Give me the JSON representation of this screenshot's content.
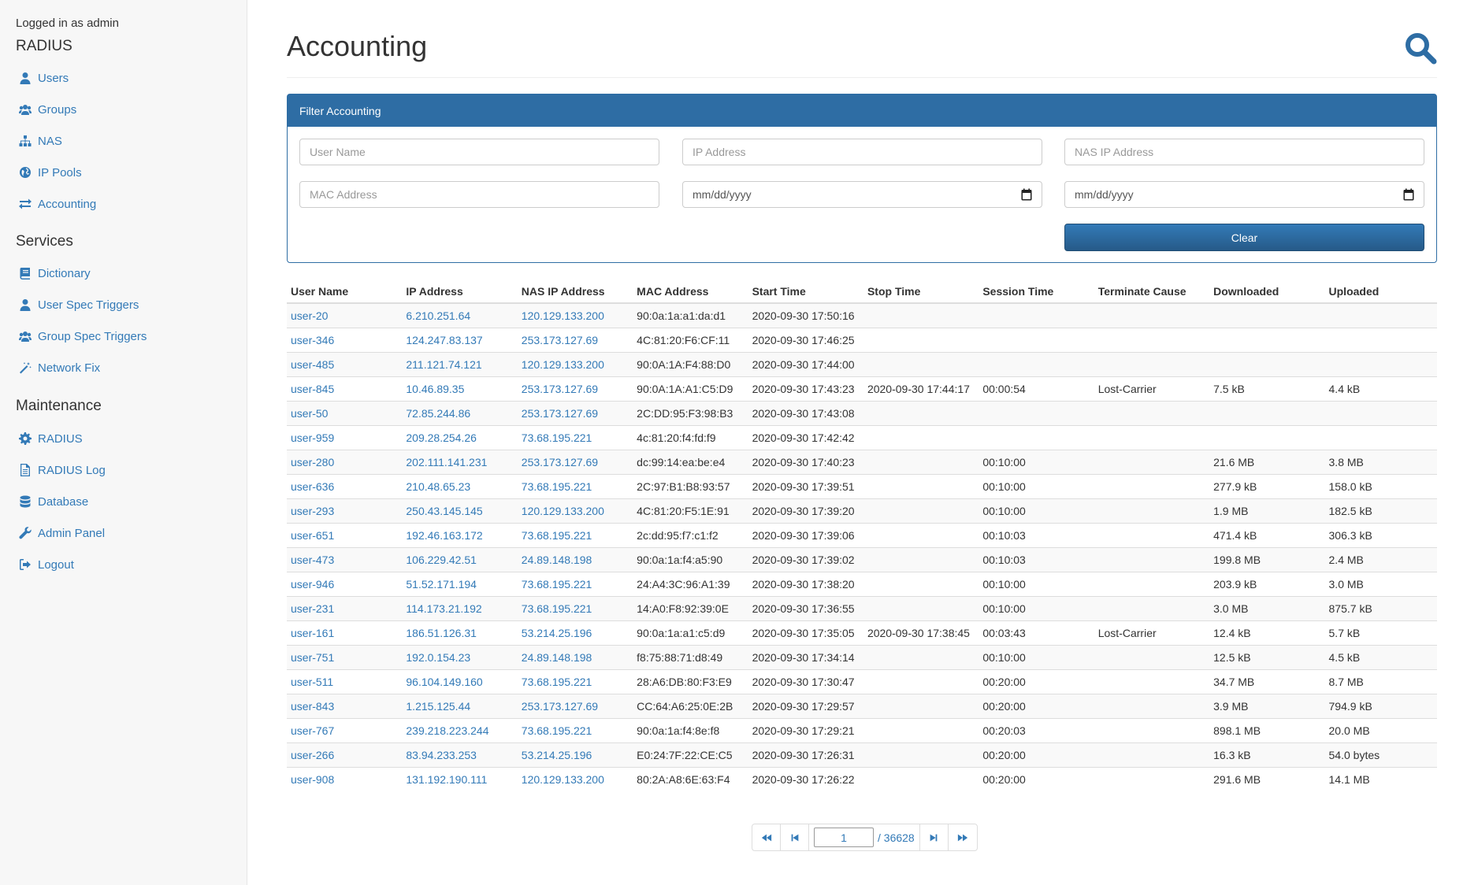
{
  "sidebar": {
    "logged_in": "Logged in as admin",
    "sections": [
      {
        "title": "RADIUS",
        "items": [
          {
            "label": "Users",
            "icon": "user-icon"
          },
          {
            "label": "Groups",
            "icon": "users-icon"
          },
          {
            "label": "NAS",
            "icon": "sitemap-icon"
          },
          {
            "label": "IP Pools",
            "icon": "globe-icon"
          },
          {
            "label": "Accounting",
            "icon": "exchange-icon"
          }
        ]
      },
      {
        "title": "Services",
        "items": [
          {
            "label": "Dictionary",
            "icon": "book-icon"
          },
          {
            "label": "User Spec Triggers",
            "icon": "user-icon"
          },
          {
            "label": "Group Spec Triggers",
            "icon": "users-icon"
          },
          {
            "label": "Network Fix",
            "icon": "magic-icon"
          }
        ]
      },
      {
        "title": "Maintenance",
        "items": [
          {
            "label": "RADIUS",
            "icon": "gear-icon"
          },
          {
            "label": "RADIUS Log",
            "icon": "file-text-icon"
          },
          {
            "label": "Database",
            "icon": "database-icon"
          },
          {
            "label": "Admin Panel",
            "icon": "wrench-icon"
          },
          {
            "label": "Logout",
            "icon": "sign-out-icon"
          }
        ]
      }
    ]
  },
  "main": {
    "title": "Accounting",
    "filter": {
      "title": "Filter Accounting",
      "user_name_placeholder": "User Name",
      "ip_placeholder": "IP Address",
      "nas_ip_placeholder": "NAS IP Address",
      "mac_placeholder": "MAC Address",
      "date_from": "mm/dd/yyyy",
      "date_to": "mm/dd/yyyy",
      "clear_label": "Clear"
    },
    "table": {
      "columns": [
        "User Name",
        "IP Address",
        "NAS IP Address",
        "MAC Address",
        "Start Time",
        "Stop Time",
        "Session Time",
        "Terminate Cause",
        "Downloaded",
        "Uploaded"
      ],
      "rows": [
        [
          "user-20",
          "6.210.251.64",
          "120.129.133.200",
          "90:0a:1a:a1:da:d1",
          "2020-09-30 17:50:16",
          "",
          "",
          "",
          "",
          ""
        ],
        [
          "user-346",
          "124.247.83.137",
          "253.173.127.69",
          "4C:81:20:F6:CF:11",
          "2020-09-30 17:46:25",
          "",
          "",
          "",
          "",
          ""
        ],
        [
          "user-485",
          "211.121.74.121",
          "120.129.133.200",
          "90:0A:1A:F4:88:D0",
          "2020-09-30 17:44:00",
          "",
          "",
          "",
          "",
          ""
        ],
        [
          "user-845",
          "10.46.89.35",
          "253.173.127.69",
          "90:0A:1A:A1:C5:D9",
          "2020-09-30 17:43:23",
          "2020-09-30 17:44:17",
          "00:00:54",
          "Lost-Carrier",
          "7.5 kB",
          "4.4 kB"
        ],
        [
          "user-50",
          "72.85.244.86",
          "253.173.127.69",
          "2C:DD:95:F3:98:B3",
          "2020-09-30 17:43:08",
          "",
          "",
          "",
          "",
          ""
        ],
        [
          "user-959",
          "209.28.254.26",
          "73.68.195.221",
          "4c:81:20:f4:fd:f9",
          "2020-09-30 17:42:42",
          "",
          "",
          "",
          "",
          ""
        ],
        [
          "user-280",
          "202.111.141.231",
          "253.173.127.69",
          "dc:99:14:ea:be:e4",
          "2020-09-30 17:40:23",
          "",
          "00:10:00",
          "",
          "21.6 MB",
          "3.8 MB"
        ],
        [
          "user-636",
          "210.48.65.23",
          "73.68.195.221",
          "2C:97:B1:B8:93:57",
          "2020-09-30 17:39:51",
          "",
          "00:10:00",
          "",
          "277.9 kB",
          "158.0 kB"
        ],
        [
          "user-293",
          "250.43.145.145",
          "120.129.133.200",
          "4C:81:20:F5:1E:91",
          "2020-09-30 17:39:20",
          "",
          "00:10:00",
          "",
          "1.9 MB",
          "182.5 kB"
        ],
        [
          "user-651",
          "192.46.163.172",
          "73.68.195.221",
          "2c:dd:95:f7:c1:f2",
          "2020-09-30 17:39:06",
          "",
          "00:10:03",
          "",
          "471.4 kB",
          "306.3 kB"
        ],
        [
          "user-473",
          "106.229.42.51",
          "24.89.148.198",
          "90:0a:1a:f4:a5:90",
          "2020-09-30 17:39:02",
          "",
          "00:10:03",
          "",
          "199.8 MB",
          "2.4 MB"
        ],
        [
          "user-946",
          "51.52.171.194",
          "73.68.195.221",
          "24:A4:3C:96:A1:39",
          "2020-09-30 17:38:20",
          "",
          "00:10:00",
          "",
          "203.9 kB",
          "3.0 MB"
        ],
        [
          "user-231",
          "114.173.21.192",
          "73.68.195.221",
          "14:A0:F8:92:39:0E",
          "2020-09-30 17:36:55",
          "",
          "00:10:00",
          "",
          "3.0 MB",
          "875.7 kB"
        ],
        [
          "user-161",
          "186.51.126.31",
          "53.214.25.196",
          "90:0a:1a:a1:c5:d9",
          "2020-09-30 17:35:05",
          "2020-09-30 17:38:45",
          "00:03:43",
          "Lost-Carrier",
          "12.4 kB",
          "5.7 kB"
        ],
        [
          "user-751",
          "192.0.154.23",
          "24.89.148.198",
          "f8:75:88:71:d8:49",
          "2020-09-30 17:34:14",
          "",
          "00:10:00",
          "",
          "12.5 kB",
          "4.5 kB"
        ],
        [
          "user-511",
          "96.104.149.160",
          "73.68.195.221",
          "28:A6:DB:80:F3:E9",
          "2020-09-30 17:30:47",
          "",
          "00:20:00",
          "",
          "34.7 MB",
          "8.7 MB"
        ],
        [
          "user-843",
          "1.215.125.44",
          "253.173.127.69",
          "CC:64:A6:25:0E:2B",
          "2020-09-30 17:29:57",
          "",
          "00:20:00",
          "",
          "3.9 MB",
          "794.9 kB"
        ],
        [
          "user-767",
          "239.218.223.244",
          "73.68.195.221",
          "90:0a:1a:f4:8e:f8",
          "2020-09-30 17:29:21",
          "",
          "00:20:03",
          "",
          "898.1 MB",
          "20.0 MB"
        ],
        [
          "user-266",
          "83.94.233.253",
          "53.214.25.196",
          "E0:24:7F:22:CE:C5",
          "2020-09-30 17:26:31",
          "",
          "00:20:00",
          "",
          "16.3 kB",
          "54.0 bytes"
        ],
        [
          "user-908",
          "131.192.190.111",
          "120.129.133.200",
          "80:2A:A8:6E:63:F4",
          "2020-09-30 17:26:22",
          "",
          "00:20:00",
          "",
          "291.6 MB",
          "14.1 MB"
        ]
      ]
    },
    "pagination": {
      "page": "1",
      "total": "/ 36628"
    }
  },
  "colors": {
    "accent": "#337ab7",
    "panel": "#2e6da4"
  }
}
